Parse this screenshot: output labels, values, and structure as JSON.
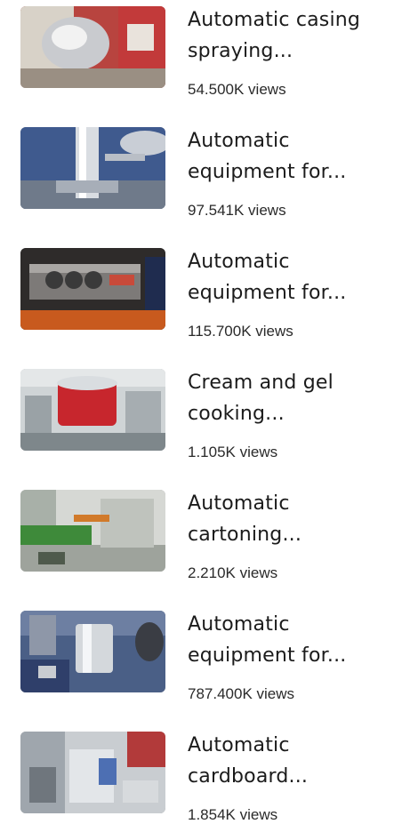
{
  "videos": [
    {
      "title": "Automatic casing\nspraying...",
      "views": "54.500K views"
    },
    {
      "title": "Automatic\nequipment for...",
      "views": "97.541K views"
    },
    {
      "title": "Automatic\nequipment for...",
      "views": "115.700K views"
    },
    {
      "title": "Cream and gel\ncooking...",
      "views": "1.105K views"
    },
    {
      "title": "Automatic\ncartoning...",
      "views": "2.210K views"
    },
    {
      "title": "Automatic\nequipment for...",
      "views": "787.400K views"
    },
    {
      "title": "Automatic\ncardboard...",
      "views": "1.854K views"
    }
  ]
}
